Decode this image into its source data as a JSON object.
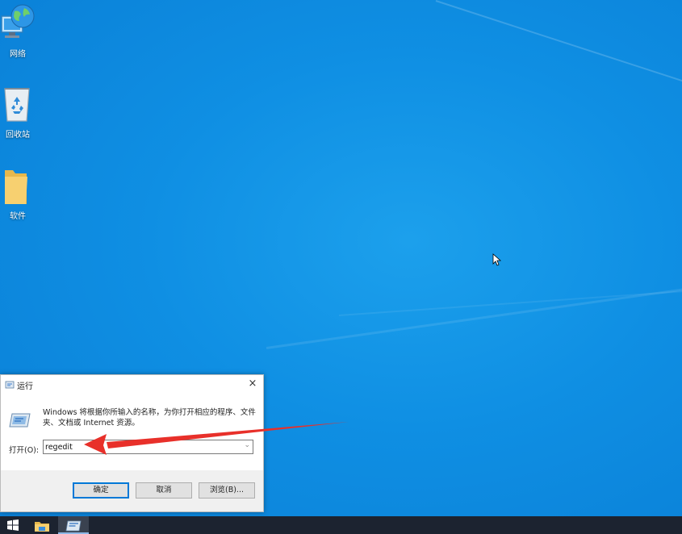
{
  "desktop": {
    "icons": [
      {
        "label": "网络",
        "icon": "network-icon"
      },
      {
        "label": "回收站",
        "icon": "recycle-bin-icon"
      },
      {
        "label": "软件",
        "icon": "folder-icon"
      }
    ]
  },
  "run_dialog": {
    "title": "运行",
    "close_glyph": "×",
    "description": "Windows 将根据你所输入的名称，为你打开相应的程序、文件夹、文档或 Internet 资源。",
    "open_label": "打开(O):",
    "input_value": "regedit",
    "buttons": {
      "ok": "确定",
      "cancel": "取消",
      "browse": "浏览(B)..."
    }
  },
  "annotation": {
    "color": "#e8302a"
  },
  "taskbar": {
    "items": [
      "start-icon",
      "file-explorer-icon",
      "run-icon"
    ]
  },
  "colors": {
    "accent": "#0078d7",
    "desktop": "#0f8fe3",
    "taskbar": "#1c2330"
  }
}
